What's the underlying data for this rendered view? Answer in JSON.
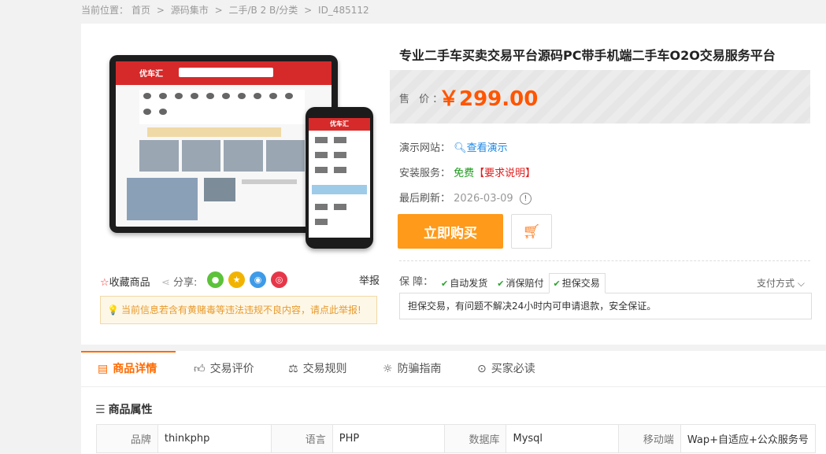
{
  "breadcrumb": {
    "prefix": "当前位置：",
    "items": [
      "首页",
      "源码集市",
      "二手/B 2 B/分类",
      "ID_485112"
    ],
    "separator": ">"
  },
  "product": {
    "title": "专业二手车买卖交易平台源码PC带手机端二手车O2O交易服务平台",
    "price_label": "售 价：",
    "price": "￥299.00",
    "mock_brand": "优车汇"
  },
  "info": {
    "demo_label": "演示网站：",
    "demo_link": "查看演示",
    "install_label": "安装服务：",
    "install_value": "免费",
    "install_req": "【要求说明】",
    "refresh_label": "最后刷新：",
    "refresh_date": "2026-03-09"
  },
  "buttons": {
    "buy": "立即购买"
  },
  "guarantee": {
    "label": "保  障：",
    "tabs": [
      "自动发货",
      "消保赔付",
      "担保交易"
    ],
    "active_index": 2,
    "pay_method": "支付方式",
    "description": "担保交易，有问题不解决24小时内可申请退款，安全保证。"
  },
  "actions": {
    "favorite": "收藏商品",
    "share": "分享:",
    "report": "举报"
  },
  "notice": "当前信息若含有黄赌毒等违法违规不良内容，请点此举报!",
  "tabs": [
    "商品详情",
    "交易评价",
    "交易规则",
    "防骗指南",
    "买家必读"
  ],
  "attributes": {
    "title": "商品属性",
    "rows": [
      [
        {
          "k": "品牌",
          "v": "thinkphp"
        },
        {
          "k": "语言",
          "v": "PHP"
        },
        {
          "k": "数据库",
          "v": "Mysql"
        },
        {
          "k": "移动端",
          "v": "Wap+自适应+公众服务号"
        }
      ]
    ]
  },
  "colors": {
    "accent": "#ff6a00",
    "price": "#ff5500",
    "buy_button": "#ff9a1a"
  }
}
